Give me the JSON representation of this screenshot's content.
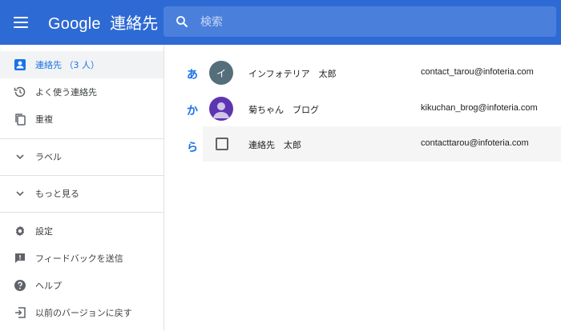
{
  "header": {
    "logo_google": "Google",
    "logo_app": "連絡先",
    "search_placeholder": "検索"
  },
  "sidebar": {
    "items": [
      {
        "label": "連絡先 （3 人）",
        "icon": "person-icon"
      },
      {
        "label": "よく使う連絡先",
        "icon": "history-icon"
      },
      {
        "label": "重複",
        "icon": "copy-icon"
      },
      {
        "label": "ラベル",
        "icon": "chevron-down-icon"
      },
      {
        "label": "もっと見る",
        "icon": "chevron-down-icon"
      },
      {
        "label": "設定",
        "icon": "gear-icon"
      },
      {
        "label": "フィードバックを送信",
        "icon": "feedback-icon"
      },
      {
        "label": "ヘルプ",
        "icon": "help-icon"
      },
      {
        "label": "以前のバージョンに戻す",
        "icon": "exit-icon"
      }
    ]
  },
  "contacts": {
    "letters": [
      "あ",
      "か",
      "ら"
    ],
    "rows": [
      {
        "avatar": "イ",
        "name": "インフォテリア　太郎",
        "email": "contact_tarou@infoteria.com"
      },
      {
        "avatar": "",
        "name": "菊ちゃん　ブログ",
        "email": "kikuchan_brog@infoteria.com"
      },
      {
        "avatar": "",
        "name": "連絡先　太郎",
        "email": "contacttarou@infoteria.com"
      }
    ]
  },
  "colors": {
    "header_bg": "#2e6ad3",
    "search_bg": "#4a80dc",
    "accent": "#1a73e8",
    "avatar_gray": "#546e7a",
    "avatar_purple": "#5e35b1"
  }
}
